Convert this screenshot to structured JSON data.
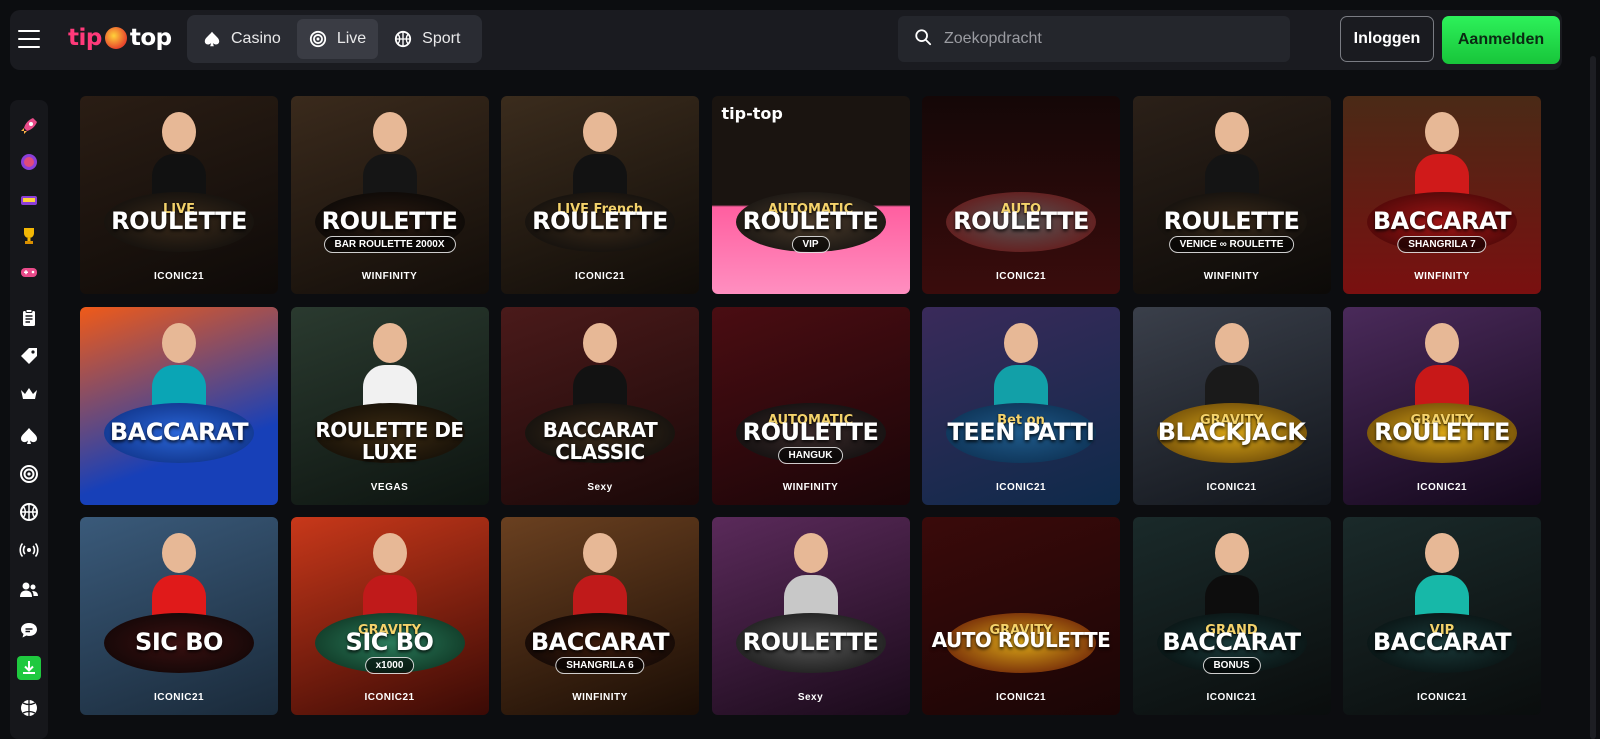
{
  "header": {
    "logo_left": "tip",
    "logo_right": "top",
    "modes": [
      {
        "label": "Casino",
        "icon": "spade-icon"
      },
      {
        "label": "Live",
        "icon": "live-target-icon"
      },
      {
        "label": "Sport",
        "icon": "ball-icon"
      }
    ],
    "active_mode": "Live",
    "search_placeholder": "Zoekopdracht",
    "login_label": "Inloggen",
    "register_label": "Aanmelden"
  },
  "sidebar": {
    "items": [
      "rocket-icon",
      "coin-icon",
      "store-icon",
      "trophy-icon",
      "gamepad-icon",
      "clipboard-icon",
      "tag-icon",
      "crown-icon",
      "spade-icon",
      "live-target-icon",
      "basketball-icon",
      "broadcast-icon",
      "users-icon",
      "chat-icon",
      "download-icon",
      "football-icon"
    ]
  },
  "games": [
    {
      "name": "ROULETTE",
      "top": "LIVE",
      "sub": "",
      "brand": "ICONIC21",
      "corner": ""
    },
    {
      "name": "ROULETTE",
      "top": "",
      "sub": "BAR ROULETTE 2000X",
      "brand": "WINFINITY",
      "corner": ""
    },
    {
      "name": "ROULETTE",
      "top": "LIVE  French",
      "sub": "",
      "brand": "ICONIC21",
      "corner": ""
    },
    {
      "name": "ROULETTE",
      "top": "AUTOMATIC",
      "sub": "VIP",
      "brand": "",
      "corner": "tip-top"
    },
    {
      "name": "ROULETTE",
      "top": "AUTO",
      "sub": "",
      "brand": "ICONIC21",
      "corner": ""
    },
    {
      "name": "ROULETTE",
      "top": "",
      "sub": "VENICE ∞ ROULETTE",
      "brand": "WINFINITY",
      "corner": ""
    },
    {
      "name": "BACCARAT",
      "top": "",
      "sub": "SHANGRILA 7",
      "brand": "WINFINITY",
      "corner": ""
    },
    {
      "name": "BACCARAT",
      "top": "",
      "sub": "",
      "brand": "",
      "corner": ""
    },
    {
      "name": "ROULETTE DE LUXE",
      "top": "",
      "sub": "",
      "brand": "VEGAS",
      "corner": ""
    },
    {
      "name": "BACCARAT CLASSIC",
      "top": "",
      "sub": "",
      "brand": "Sexy",
      "corner": ""
    },
    {
      "name": "ROULETTE",
      "top": "AUTOMATIC",
      "sub": "HANGUK",
      "brand": "WINFINITY",
      "corner": ""
    },
    {
      "name": "TEEN PATTI",
      "top": "Bet on",
      "sub": "",
      "brand": "ICONIC21",
      "corner": ""
    },
    {
      "name": "BLACKJACK",
      "top": "GRAVITY",
      "sub": "",
      "brand": "ICONIC21",
      "corner": ""
    },
    {
      "name": "ROULETTE",
      "top": "GRAVITY",
      "sub": "",
      "brand": "ICONIC21",
      "corner": ""
    },
    {
      "name": "SIC BO",
      "top": "",
      "sub": "",
      "brand": "ICONIC21",
      "corner": ""
    },
    {
      "name": "SIC BO",
      "top": "GRAVITY",
      "sub": "x1000",
      "brand": "ICONIC21",
      "corner": ""
    },
    {
      "name": "BACCARAT",
      "top": "",
      "sub": "SHANGRILA 6",
      "brand": "WINFINITY",
      "corner": ""
    },
    {
      "name": "ROULETTE",
      "top": "",
      "sub": "",
      "brand": "Sexy",
      "corner": ""
    },
    {
      "name": "AUTO ROULETTE",
      "top": "GRAVITY",
      "sub": "",
      "brand": "ICONIC21",
      "corner": ""
    },
    {
      "name": "BACCARAT",
      "top": "GRAND",
      "sub": "BONUS",
      "brand": "ICONIC21",
      "corner": ""
    },
    {
      "name": "BACCARAT",
      "top": "VIP",
      "sub": "",
      "brand": "ICONIC21",
      "corner": ""
    }
  ],
  "theme": {
    "accent_green": "#22d84a",
    "background": "#0c0d10",
    "panel": "#1a1b20"
  }
}
